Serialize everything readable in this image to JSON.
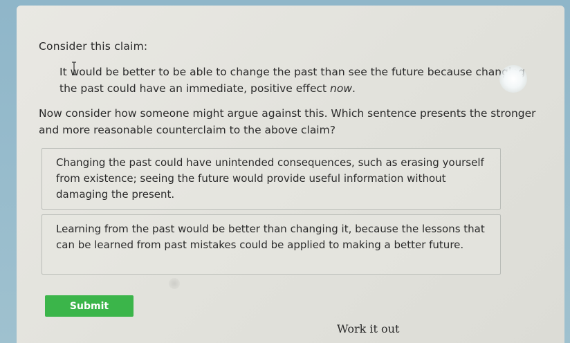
{
  "question": {
    "prompt": "Consider this claim:",
    "claim_text": "It would be better to be able to change the past than see the future because changing the past could have an immediate, positive effect ",
    "claim_emphasis": "now",
    "claim_end": ".",
    "instruction": "Now consider how someone might argue against this. Which sentence presents the stronger and more reasonable counterclaim to the above claim?"
  },
  "choices": [
    {
      "label": "Changing the past could have unintended consequences, such as erasing yourself from existence; seeing the future would provide useful information without damaging the present."
    },
    {
      "label": "Learning from the past would be better than changing it, because the lessons that can be learned from past mistakes could be applied to making a better future."
    }
  ],
  "actions": {
    "submit_label": "Submit",
    "work_label": "Work it out"
  },
  "colors": {
    "submit_bg": "#3bb54a",
    "page_bg": "#e5e5df"
  },
  "icons": {
    "text_cursor": "i-beam-cursor-icon"
  }
}
